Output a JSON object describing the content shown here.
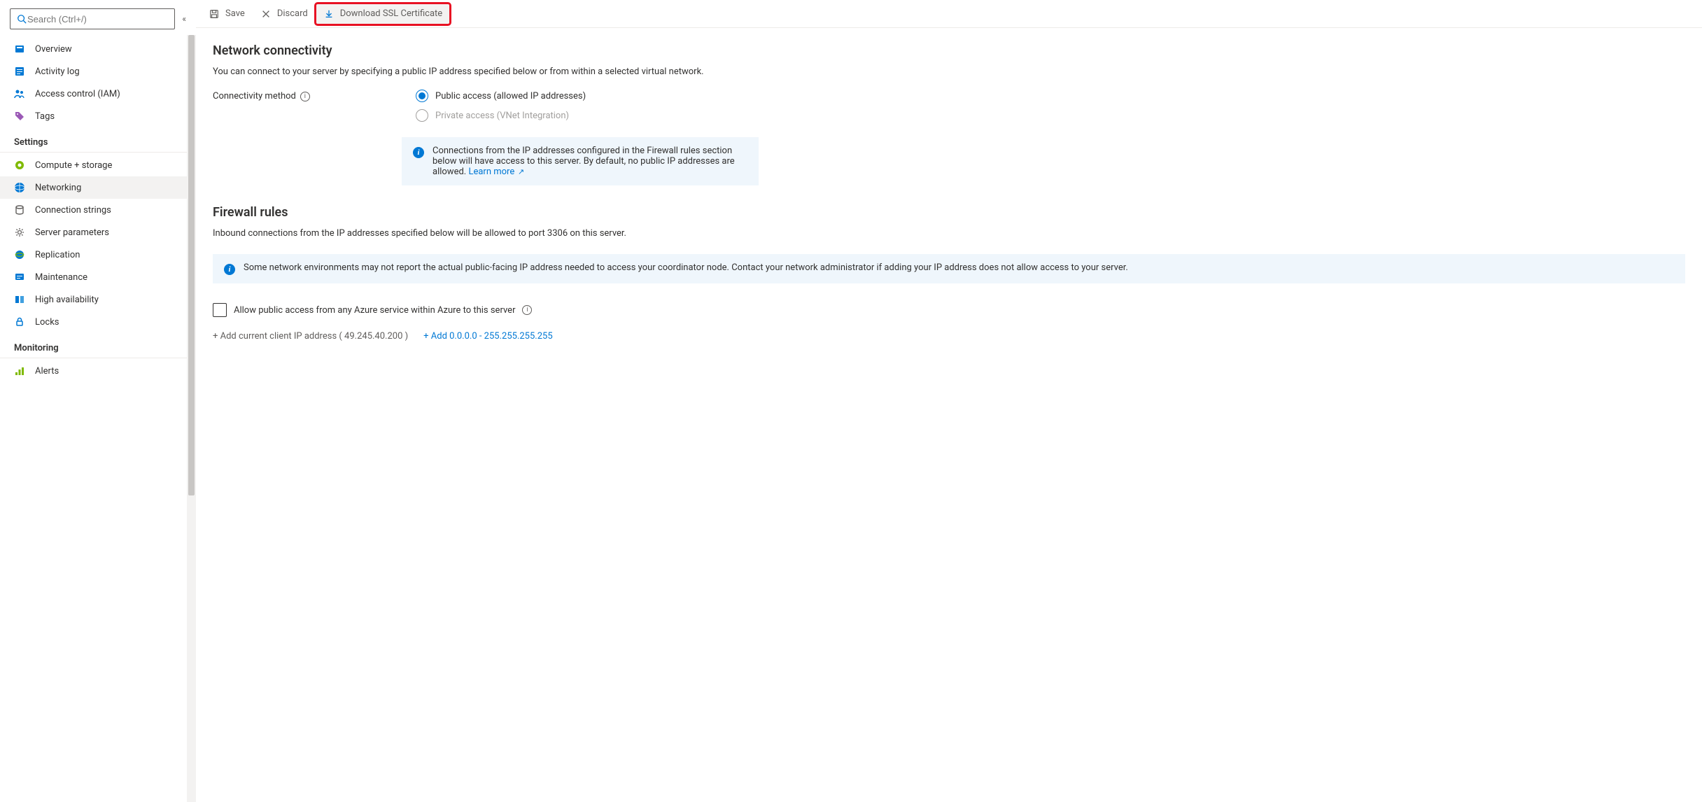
{
  "sidebar": {
    "search_placeholder": "Search (Ctrl+/)",
    "items_top": [
      {
        "label": "Overview",
        "icon": "overview"
      },
      {
        "label": "Activity log",
        "icon": "activity"
      },
      {
        "label": "Access control (IAM)",
        "icon": "iam"
      },
      {
        "label": "Tags",
        "icon": "tags"
      }
    ],
    "heading_settings": "Settings",
    "items_settings": [
      {
        "label": "Compute + storage",
        "icon": "compute"
      },
      {
        "label": "Networking",
        "icon": "networking",
        "active": true
      },
      {
        "label": "Connection strings",
        "icon": "conn"
      },
      {
        "label": "Server parameters",
        "icon": "gear"
      },
      {
        "label": "Replication",
        "icon": "globe"
      },
      {
        "label": "Maintenance",
        "icon": "maint"
      },
      {
        "label": "High availability",
        "icon": "ha"
      },
      {
        "label": "Locks",
        "icon": "lock"
      }
    ],
    "heading_monitoring": "Monitoring",
    "items_monitoring": [
      {
        "label": "Alerts",
        "icon": "alerts"
      }
    ]
  },
  "toolbar": {
    "save": "Save",
    "discard": "Discard",
    "download": "Download SSL Certificate"
  },
  "main": {
    "netconn_title": "Network connectivity",
    "netconn_desc": "You can connect to your server by specifying a public IP address specified below or from within a selected virtual network.",
    "conn_label": "Connectivity method",
    "radio_public": "Public access (allowed IP addresses)",
    "radio_private": "Private access (VNet Integration)",
    "infobox1": "Connections from the IP addresses configured in the Firewall rules section below will have access to this server. By default, no public IP addresses are allowed.",
    "learn_more": "Learn more",
    "fw_title": "Firewall rules",
    "fw_desc": "Inbound connections from the IP addresses specified below will be allowed to port 3306 on this server.",
    "infobox2": "Some network environments may not report the actual public-facing IP address needed to access your coordinator node. Contact your network administrator if adding your IP address does not allow access to your server.",
    "allow_azure": "Allow public access from any Azure service within Azure to this server",
    "add_client": "+ Add current client IP address ( 49.245.40.200 )",
    "add_range": "+ Add 0.0.0.0 - 255.255.255.255"
  }
}
